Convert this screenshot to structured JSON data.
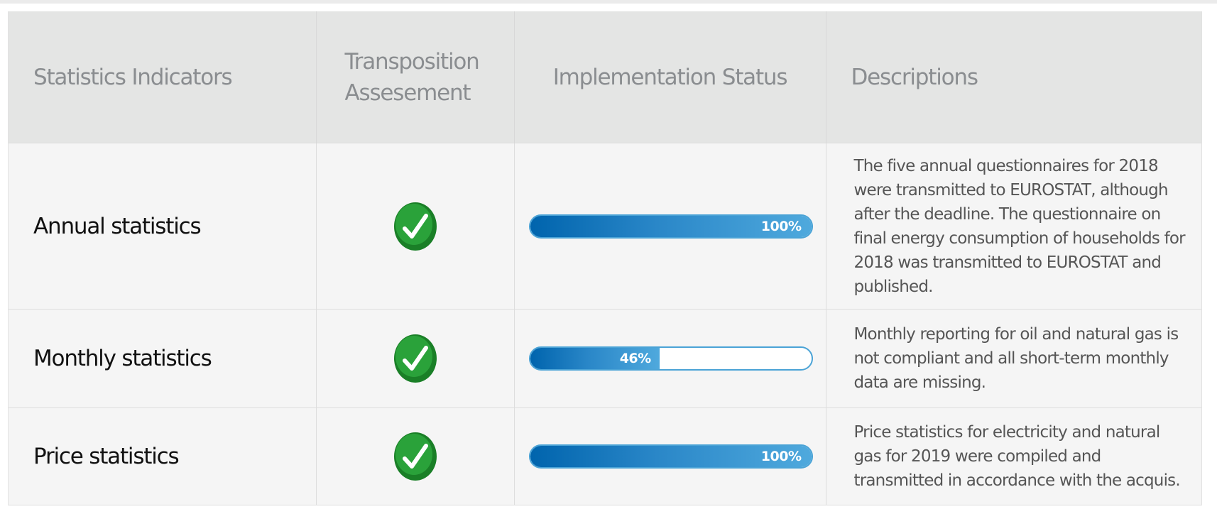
{
  "table": {
    "headers": {
      "indicator": "Statistics Indicators",
      "assessment_line1": "Transposition",
      "assessment_line2": "Assesement",
      "status": "Implementation Status",
      "descriptions": "Descriptions"
    },
    "rows": [
      {
        "indicator": "Annual statistics",
        "assessment_icon": "green-check-icon",
        "progress_percent": 100,
        "progress_label": "100%",
        "description": "The five annual questionnaires for 2018 were transmitted to EUROSTAT, although after the deadline. The questionnaire on final energy consumption of households for 2018 was transmitted to EUROSTAT and published."
      },
      {
        "indicator": "Monthly statistics",
        "assessment_icon": "green-check-icon",
        "progress_percent": 46,
        "progress_label": "46%",
        "description": "Monthly reporting for oil and natural gas is not compliant and all short-term monthly data are missing."
      },
      {
        "indicator": "Price statistics",
        "assessment_icon": "green-check-icon",
        "progress_percent": 100,
        "progress_label": "100%",
        "description": "Price statistics for electricity and natural gas for 2019 were compiled and transmitted in accordance with the acquis."
      }
    ]
  },
  "colors": {
    "progress_fill_start": "#0064ad",
    "progress_fill_end": "#4fa9dd",
    "progress_border": "#4aa3d6",
    "check_green": "#1f8a2b",
    "header_bg": "#e4e5e4",
    "row_bg": "#f5f5f5"
  }
}
